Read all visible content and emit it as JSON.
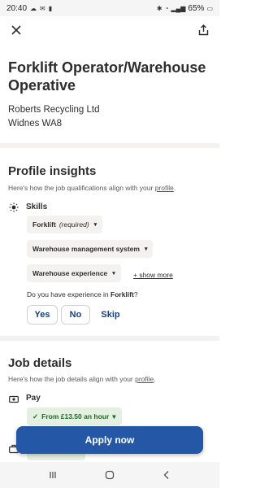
{
  "status_bar": {
    "time": "20:40",
    "battery": "65%"
  },
  "header": {
    "close_icon": "close-icon",
    "share_icon": "share-icon"
  },
  "job": {
    "title": "Forklift Operator/Warehouse Operative",
    "company": "Roberts Recycling Ltd",
    "location": "Widnes WA8"
  },
  "profile_insights": {
    "title": "Profile insights",
    "subtitle_prefix": "Here's how the job qualifications align with your ",
    "subtitle_link": "profile",
    "subtitle_suffix": ".",
    "skills_label": "Skills",
    "skills": [
      {
        "label": "Forklift",
        "qualifier": "(required)"
      },
      {
        "label": "Warehouse management system",
        "qualifier": ""
      },
      {
        "label": "Warehouse experience",
        "qualifier": ""
      }
    ],
    "show_more": "+ show more",
    "question_prefix": "Do you have experience in ",
    "question_skill": "Forklift",
    "question_suffix": "?",
    "answers": {
      "yes": "Yes",
      "no": "No",
      "skip": "Skip"
    }
  },
  "job_details": {
    "title": "Job details",
    "subtitle_prefix": "Here's how the job details align with your ",
    "subtitle_link": "profile",
    "subtitle_suffix": ".",
    "pay_label": "Pay",
    "pay_value": "From £13.50 an hour"
  },
  "apply_button": "Apply now",
  "colors": {
    "primary": "#2557a7",
    "link_text": "#164081",
    "pay_bg": "#e4f0e0",
    "pay_text": "#1f662c"
  }
}
